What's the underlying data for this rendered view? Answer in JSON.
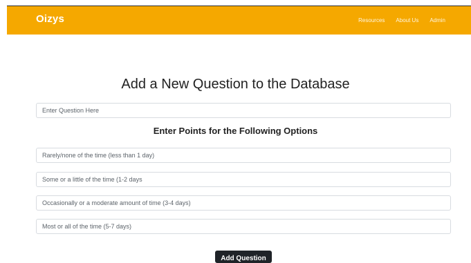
{
  "navbar": {
    "brand": "Oizys",
    "links": [
      "Resources",
      "About Us",
      "Admin"
    ]
  },
  "form": {
    "title": "Add a New Question to the Database",
    "question_placeholder": "Enter Question Here",
    "options_heading": "Enter Points for the Following Options",
    "option_placeholders": [
      "Rarely/none of the time (less than 1 day)",
      "Some or a little of the time (1-2 days",
      "Occasionally or a moderate amount of time (3-4 days)",
      "Most or all of the time (5-7 days)"
    ],
    "submit_label": "Add Question"
  },
  "colors": {
    "navbar_bg": "#f5a800",
    "button_bg": "#1f2328"
  }
}
